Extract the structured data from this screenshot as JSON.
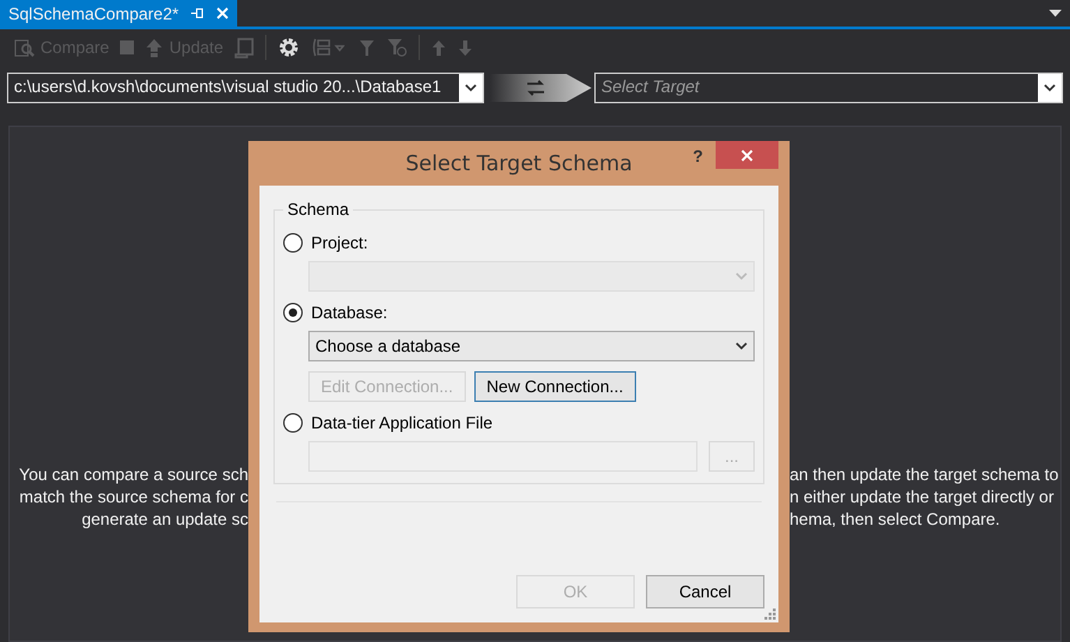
{
  "tab": {
    "title": "SqlSchemaCompare2*",
    "selected": true
  },
  "toolbar": [
    {
      "kind": "compare",
      "label": "Compare",
      "disabled": true
    },
    {
      "kind": "stop",
      "disabled": true
    },
    {
      "kind": "update",
      "label": "Update",
      "disabled": true
    },
    {
      "kind": "script",
      "disabled": true
    },
    {
      "kind": "options",
      "disabled": false
    },
    {
      "kind": "group",
      "disabled": true
    },
    {
      "kind": "filter",
      "disabled": true
    },
    {
      "kind": "filter-clear",
      "disabled": true
    },
    {
      "kind": "up",
      "disabled": true
    },
    {
      "kind": "down",
      "disabled": true
    }
  ],
  "source": {
    "value": "c:\\users\\d.kovsh\\documents\\visual studio 20...\\Database1"
  },
  "target": {
    "placeholder": "Select Target"
  },
  "description": {
    "left_lines": [
      "You can compare a source sch",
      "match the source schema for c",
      "generate an update sc"
    ],
    "right_lines": [
      "an then update the target schema to",
      "n either update the target directly or",
      "hema, then select Compare."
    ]
  },
  "dialog": {
    "title": "Select Target Schema",
    "help": "?",
    "group_label": "Schema",
    "options": [
      {
        "kind": "combo",
        "label": "Project:",
        "selected": false
      },
      {
        "kind": "combo",
        "label": "Database:",
        "selected": true,
        "value": "Choose a database",
        "buttons": [
          {
            "label": "Edit Connection...",
            "disabled": true
          },
          {
            "label": "New Connection...",
            "disabled": false
          }
        ]
      },
      {
        "kind": "file",
        "label": "Data-tier Application File",
        "selected": false,
        "browse": "..."
      }
    ],
    "buttons": [
      {
        "label": "OK",
        "disabled": true
      },
      {
        "label": "Cancel",
        "disabled": false
      }
    ]
  }
}
